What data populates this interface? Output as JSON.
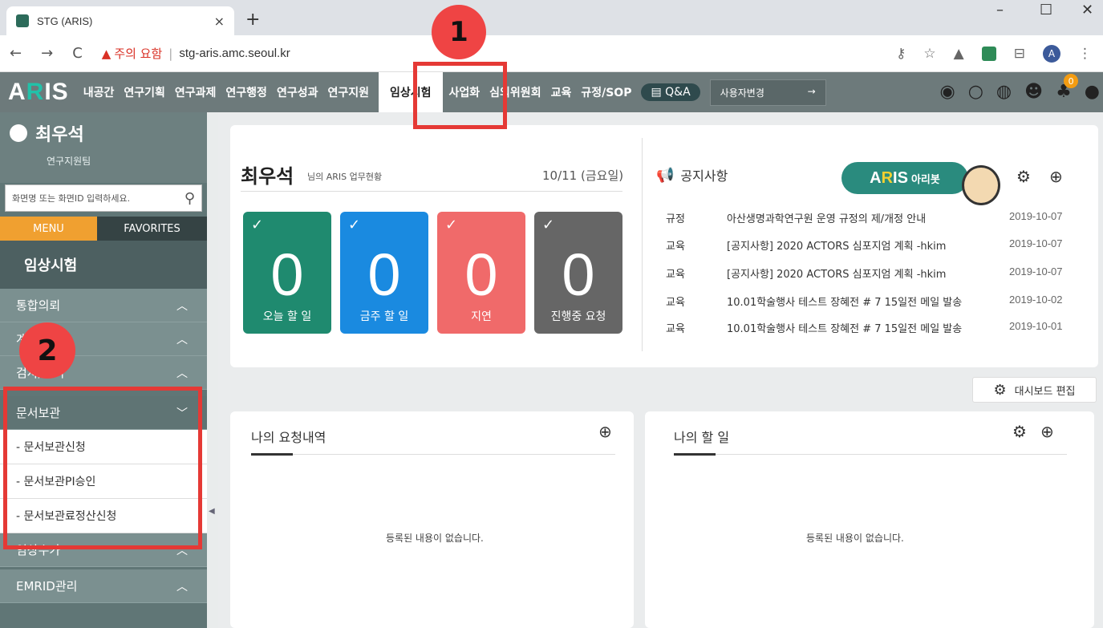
{
  "browser": {
    "tab_title": "STG (ARIS)",
    "tab_close": "×",
    "new_tab": "+",
    "minimize": "–",
    "maximize": "☐",
    "close": "✕",
    "warning_text": "주의 요함",
    "url": "stg-aris.amc.seoul.kr",
    "profile_initial": "A"
  },
  "nav": {
    "logo": "ARIS",
    "items": [
      "내공간",
      "연구기획",
      "연구과제",
      "연구행정",
      "연구성과",
      "연구지원",
      "임상시험",
      "사업화",
      "심의위원회",
      "교육",
      "규정/SOP"
    ],
    "qna": "Q&A",
    "user_change": "사용자변경",
    "user_change_arrow": "→",
    "notification_count": "0"
  },
  "annotations": {
    "one": "1",
    "two": "2"
  },
  "sidebar": {
    "user_name": "최우석",
    "team": "연구지원팀",
    "search_placeholder": "화면명 또는 화면ID 입력하세요.",
    "tab_menu": "MENU",
    "tab_favorites": "FAVORITES",
    "section_title": "임상시험",
    "menu": [
      {
        "label": "통합의뢰",
        "arrow": "^"
      },
      {
        "label": "계약관리",
        "arrow": "^"
      },
      {
        "label": "검사/관리",
        "arrow": "^"
      },
      {
        "label": "문서보관",
        "arrow": "v"
      }
    ],
    "submenu": [
      "- 문서보관신청",
      "- 문서보관PI승인",
      "- 문서보관료정산신청"
    ],
    "menu_bottom": [
      {
        "label": "임상수가",
        "arrow": "^"
      },
      {
        "label": "EMRID관리",
        "arrow": "^"
      }
    ]
  },
  "dashboard": {
    "greeting_name": "최우석",
    "greeting_sub": "님의 ARIS 업무현황",
    "date": "10/11 (금요일)",
    "tiles": [
      {
        "value": "0",
        "label": "오늘 할 일",
        "color": "#1f8a6f"
      },
      {
        "value": "0",
        "label": "금주 할 일",
        "color": "#1a8ae0"
      },
      {
        "value": "0",
        "label": "지연",
        "color": "#f06a6a"
      },
      {
        "value": "0",
        "label": "진행중 요청",
        "color": "#666666"
      }
    ],
    "notice_title": "공지사항",
    "arisbot_small": "아리봇",
    "notices": [
      {
        "cat": "규정",
        "text": "아산생명과학연구원 운영 규정의 제/개정 안내",
        "date": "2019-10-07"
      },
      {
        "cat": "교육",
        "text": "[공지사항] 2020 ACTORS 심포지엄 계획 -hkim",
        "date": "2019-10-07"
      },
      {
        "cat": "교육",
        "text": "[공지사항] 2020 ACTORS 심포지엄 계획 -hkim",
        "date": "2019-10-07"
      },
      {
        "cat": "교육",
        "text": "10.01학술행사 테스트 장혜전 # 7 15일전 메일 발송",
        "date": "2019-10-02"
      },
      {
        "cat": "교육",
        "text": "10.01학술행사 테스트 장혜전 # 7 15일전 메일 발송",
        "date": "2019-10-01"
      }
    ],
    "dashboard_edit": "대시보드 편집",
    "my_requests": "나의 요청내역",
    "my_todo": "나의 할 일",
    "empty_text": "등록된 내용이 없습니다."
  }
}
